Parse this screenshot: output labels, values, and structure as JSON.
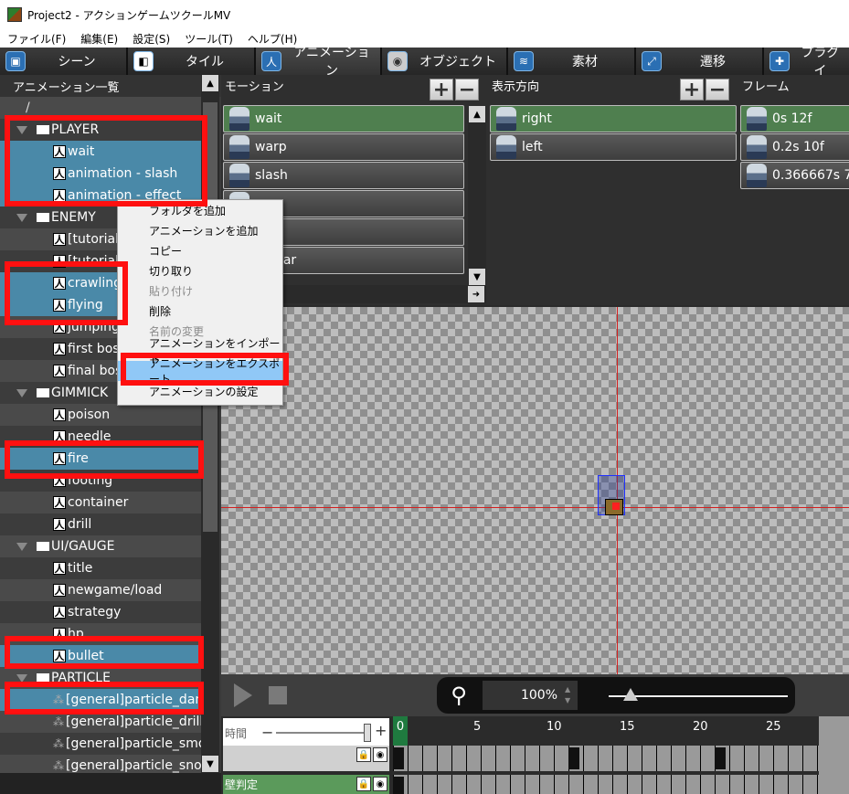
{
  "window": {
    "title": "Project2 - アクションゲームツクールMV"
  },
  "menubar": [
    "ファイル(F)",
    "編集(E)",
    "設定(S)",
    "ツール(T)",
    "ヘルプ(H)"
  ],
  "tabs": [
    {
      "label": "シーン",
      "icon": "scene-icon"
    },
    {
      "label": "タイル",
      "icon": "tile-icon"
    },
    {
      "label": "アニメーション",
      "icon": "animation-icon",
      "active": true
    },
    {
      "label": "オブジェクト",
      "icon": "object-icon"
    },
    {
      "label": "素材",
      "icon": "material-icon"
    },
    {
      "label": "遷移",
      "icon": "transition-icon"
    },
    {
      "label": "プラグイ",
      "icon": "plugin-icon"
    }
  ],
  "left_panel": {
    "title": "アニメーション一覧",
    "root": "/",
    "tree": [
      {
        "type": "folder",
        "label": "PLAYER"
      },
      {
        "type": "anim",
        "label": "wait",
        "selected": true
      },
      {
        "type": "anim",
        "label": "animation - slash",
        "selected": true
      },
      {
        "type": "anim",
        "label": "animation - effect",
        "selected": true
      },
      {
        "type": "folder",
        "label": "ENEMY"
      },
      {
        "type": "anim",
        "label": "[tutorial]"
      },
      {
        "type": "anim",
        "label": "[tutorial]"
      },
      {
        "type": "anim",
        "label": "crawling",
        "selected": true
      },
      {
        "type": "anim",
        "label": "flying",
        "selected": true
      },
      {
        "type": "anim",
        "label": "jumping"
      },
      {
        "type": "anim",
        "label": "first boss"
      },
      {
        "type": "anim",
        "label": "final boss"
      },
      {
        "type": "folder",
        "label": "GIMMICK"
      },
      {
        "type": "anim",
        "label": "poison"
      },
      {
        "type": "anim",
        "label": "needle"
      },
      {
        "type": "anim",
        "label": "fire",
        "selected": true
      },
      {
        "type": "anim",
        "label": "footing"
      },
      {
        "type": "anim",
        "label": "container"
      },
      {
        "type": "anim",
        "label": "drill"
      },
      {
        "type": "folder",
        "label": "UI/GAUGE"
      },
      {
        "type": "anim",
        "label": "title"
      },
      {
        "type": "anim",
        "label": "newgame/load"
      },
      {
        "type": "anim",
        "label": "strategy"
      },
      {
        "type": "anim",
        "label": "hp"
      },
      {
        "type": "anim",
        "label": "bullet",
        "selected": true
      },
      {
        "type": "folder",
        "label": "PARTICLE"
      },
      {
        "type": "particle",
        "label": "[general]particle_dam",
        "selected": true
      },
      {
        "type": "particle",
        "label": "[general]particle_drill"
      },
      {
        "type": "particle",
        "label": "[general]particle_smo"
      },
      {
        "type": "particle",
        "label": "[general]particle_snov"
      }
    ]
  },
  "motion_panel": {
    "title": "モーション",
    "items": [
      {
        "label": "wait",
        "selected": true
      },
      {
        "label": "warp"
      },
      {
        "label": "slash"
      },
      {
        "label": "..."
      },
      {
        "label": "...n"
      },
      {
        "label": "...pear"
      }
    ]
  },
  "direction_panel": {
    "title": "表示方向",
    "items": [
      {
        "label": "right",
        "selected": true
      },
      {
        "label": "left"
      }
    ]
  },
  "frame_panel": {
    "title": "フレーム",
    "items": [
      {
        "label": "0s 12f",
        "selected": true
      },
      {
        "label": "0.2s 10f"
      },
      {
        "label": "0.366667s 7"
      }
    ]
  },
  "context_menu": {
    "items": [
      {
        "label": "フォルダを追加",
        "enabled": true
      },
      {
        "label": "アニメーションを追加",
        "enabled": true
      },
      {
        "label": "コピー",
        "enabled": true
      },
      {
        "label": "切り取り",
        "enabled": true
      },
      {
        "label": "貼り付け",
        "enabled": false
      },
      {
        "label": "削除",
        "enabled": true
      },
      {
        "label": "名前の変更",
        "enabled": false
      },
      {
        "label": "アニメーションをインポート",
        "enabled": true
      },
      {
        "label": "アニメーションをエクスポート",
        "enabled": true,
        "highlighted": true
      },
      {
        "label": "アニメーションの設定",
        "enabled": true
      }
    ]
  },
  "playback": {
    "zoom": "100%",
    "zoom_level": 0.12
  },
  "timeline": {
    "time_label": "時間",
    "ticks": [
      "0",
      "5",
      "10",
      "15",
      "20",
      "25"
    ],
    "tracks": [
      {
        "label": "",
        "style": "plain"
      },
      {
        "label": "壁判定",
        "style": "green"
      }
    ]
  },
  "colors": {
    "accent_selected": "#4a89a8",
    "list_selected": "#4f7f4f",
    "annotation_red": "#ff1010",
    "menu_highlight": "#90c8f6"
  }
}
